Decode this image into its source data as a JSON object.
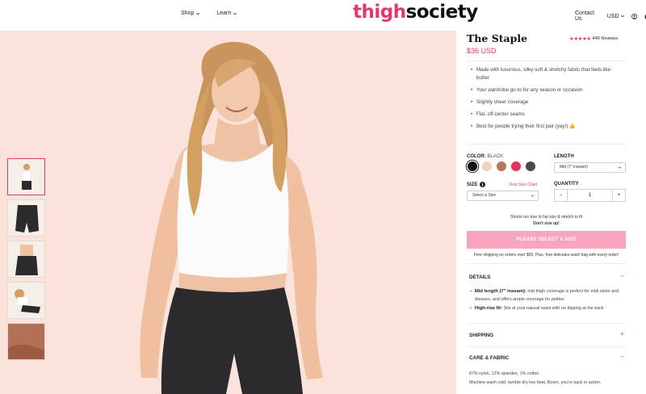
{
  "header": {
    "nav_left": [
      {
        "label": "Shop"
      },
      {
        "label": "Learn"
      }
    ],
    "logo_part1": "thigh",
    "logo_part2": "society",
    "contact": "Contact Us",
    "currency": "USD"
  },
  "colors": {
    "accent": "#e2386e",
    "hero_bg": "#fbe3dc",
    "button_disabled": "#f8a5bd"
  },
  "product": {
    "title": "The Staple",
    "stars": "★★★★★",
    "reviews": "449 Reviews",
    "price": "$36 USD",
    "bullets": [
      "Made with luxurious, silky-soft & stretchy fabric that feels like butter",
      "Your wardrobe go-to for any season or occasion",
      "Slightly sheer coverage",
      "Flat, off-center seams",
      "Best for people trying their first pair (yay!) 👍"
    ],
    "color_label": "COLOR:",
    "color_value": "BLACK",
    "swatches": [
      "#111111",
      "#f1d3b9",
      "#b5765a",
      "#e5325d",
      "#4a4a4c"
    ],
    "length_label": "LENGTH",
    "length_value": "Mid (7\" inseam)",
    "size_label": "SIZE",
    "size_chart": "View Size Chart",
    "size_placeholder": "Select a Size",
    "quantity_label": "QUANTITY",
    "quantity": "1",
    "fit_note": "Shorts run true to hip size & stretch to fit",
    "fit_note_bold": "Don't size up!",
    "add_button": "PLEASE SELECT A SIZE",
    "shipping_note": "Free shipping on orders over $50. Plus, free delicates wash bag with every order!"
  },
  "accordion": {
    "details_title": "DETAILS",
    "details_items": [
      {
        "bold": "Mid length (7\" inseam):",
        "text": " mid thigh coverage is perfect for midi skirts and dresses, and offers ample coverage for petites"
      },
      {
        "bold": "High-rise fit:",
        "text": " Sits at your natural waist with no dipping at the back"
      }
    ],
    "shipping_title": "SHIPPING",
    "care_title": "CARE & FABRIC",
    "care_lines": [
      "87% nylon, 12% spandex, 1% cotton",
      "Machine wash cold, tumble dry low heat. Boom, you're back in action."
    ]
  }
}
